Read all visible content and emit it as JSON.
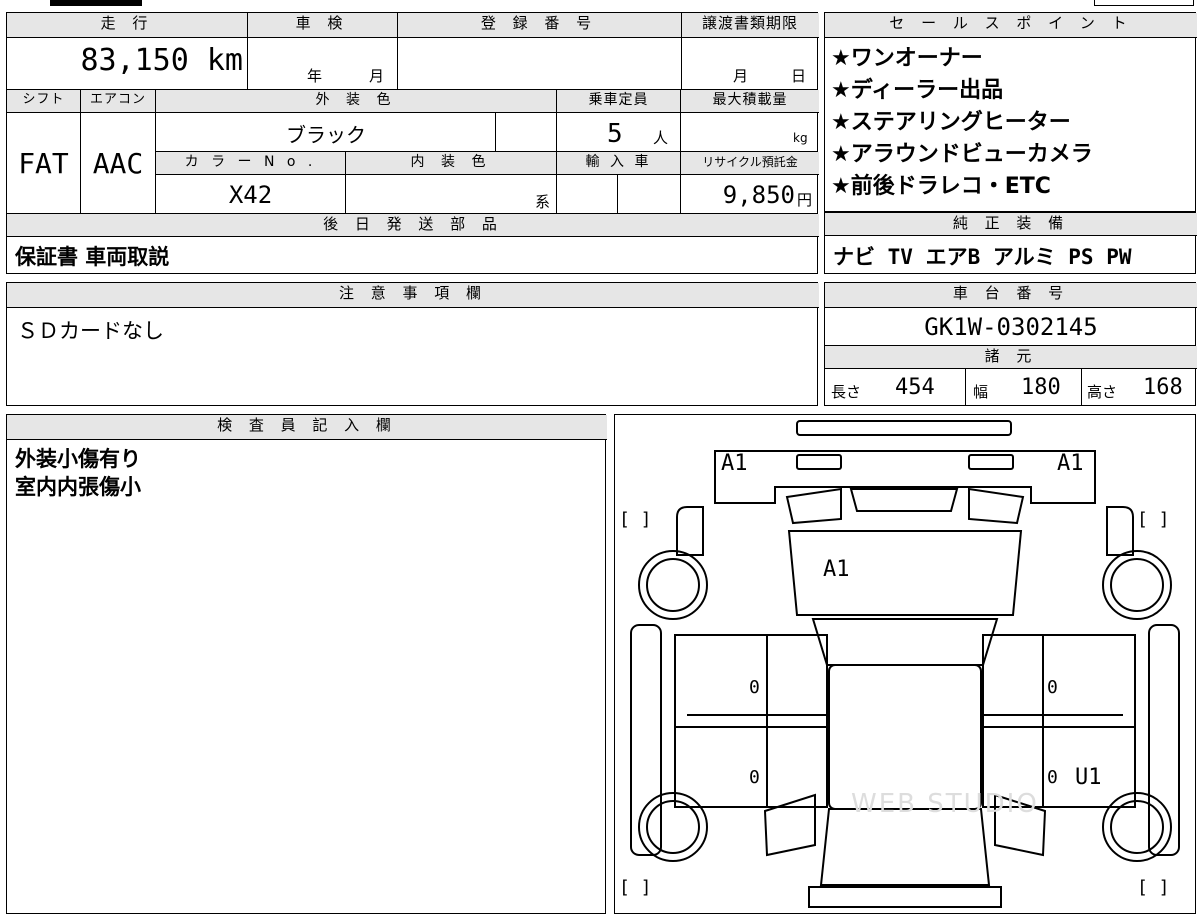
{
  "top": {
    "mileage_label": "走 行",
    "mileage_value": "83,150 km",
    "inspection_label": "車 検",
    "inspection_year": "年",
    "inspection_month": "月",
    "registration_label": "登 録 番 号",
    "transfer_label": "譲渡書類期限",
    "transfer_month": "月",
    "transfer_day": "日",
    "shift_label": "シフト",
    "shift_value": "FAT",
    "aircon_label": "エアコン",
    "aircon_value": "AAC",
    "exterior_label": "外 装 色",
    "exterior_value": "ブラック",
    "capacity_label": "乗車定員",
    "capacity_value": "5",
    "capacity_unit": "人",
    "maxload_label": "最大積載量",
    "maxload_unit": "kg",
    "colorno_label": "カ ラ ー N o .",
    "colorno_value": "X42",
    "interior_label": "内 装 色",
    "interior_suffix": "系",
    "import_label": "輸 入 車",
    "recycle_label": "リサイクル預託金",
    "recycle_value": "9,850",
    "recycle_unit": "円"
  },
  "sales": {
    "label": "セ ー ル ス ポ イ ン ト",
    "points": [
      "★ワンオーナー",
      "★ディーラー出品",
      "★ステアリングヒーター",
      "★アラウンドビューカメラ",
      "★前後ドラレコ・ETC"
    ]
  },
  "shipping": {
    "label": "後 日 発 送 部 品",
    "value": "保証書 車両取説"
  },
  "equipment": {
    "label": "純 正 装 備",
    "value": "ナビ TV エアB アルミ PS PW"
  },
  "notes": {
    "label": "注 意 事 項 欄",
    "value": "ＳＤカードなし"
  },
  "chassis": {
    "label": "車 台 番 号",
    "value": "GK1W-0302145"
  },
  "specs": {
    "label": "諸 元",
    "length_label": "長さ",
    "length_value": "454",
    "width_label": "幅",
    "width_value": "180",
    "height_label": "高さ",
    "height_value": "168"
  },
  "inspector": {
    "label": "検 査 員 記 入 欄",
    "lines": [
      "外装小傷有り",
      "室内内張傷小"
    ]
  },
  "diagram": {
    "marks": {
      "front_left": "A1",
      "front_right": "A1",
      "hood": "A1",
      "left_front_door": "0",
      "left_rear_door": "0",
      "right_front_door": "0",
      "right_rear_door": "0",
      "right_rear": "U1"
    },
    "bracket": "[  ]",
    "watermark": "WEB STUDIO"
  }
}
